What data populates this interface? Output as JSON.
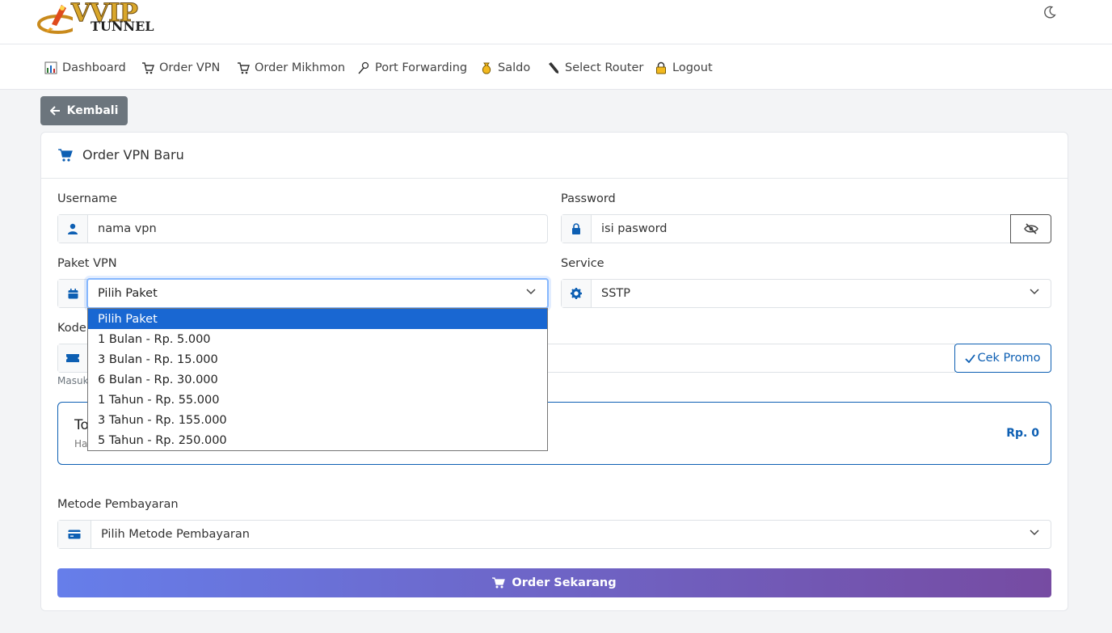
{
  "brand": {
    "logo_main": "VVIP",
    "logo_sub": "TUNNEL"
  },
  "nav": [
    {
      "label": "Dashboard",
      "icon": "chart-icon"
    },
    {
      "label": "Order VPN",
      "icon": "cart-icon"
    },
    {
      "label": "Order Mikhmon",
      "icon": "cart-icon"
    },
    {
      "label": "Port Forwarding",
      "icon": "pin-icon"
    },
    {
      "label": "Saldo",
      "icon": "money-bag-icon"
    },
    {
      "label": "Select Router",
      "icon": "pen-icon"
    },
    {
      "label": "Logout",
      "icon": "lock-icon"
    }
  ],
  "back_label": "Kembali",
  "card_title": "Order VPN Baru",
  "form": {
    "username_label": "Username",
    "username_value": "nama vpn",
    "password_label": "Password",
    "password_value": "isi pasword",
    "paket_label": "Paket VPN",
    "paket_value": "Pilih Paket",
    "service_label": "Service",
    "service_value": "SSTP",
    "kode_label_visible": "Kode",
    "helper_visible": "Masuk",
    "promo_button": "Cek Promo",
    "total_title_visible": "To",
    "total_sub_visible": "Ha",
    "total_value": "Rp. 0",
    "payment_label": "Metode Pembayaran",
    "payment_value": "Pilih Metode Pembayaran",
    "order_button": "Order Sekarang"
  },
  "paket_options": [
    "Pilih Paket",
    "1 Bulan - Rp. 5.000",
    "3 Bulan - Rp. 15.000",
    "6 Bulan - Rp. 30.000",
    "1 Tahun - Rp. 55.000",
    "3 Tahun - Rp. 155.000",
    "5 Tahun - Rp. 250.000"
  ],
  "colors": {
    "primary": "#0d5fb3",
    "gradient_start": "#667eea",
    "gradient_end": "#764ba2",
    "selected_option": "#1967d2"
  }
}
